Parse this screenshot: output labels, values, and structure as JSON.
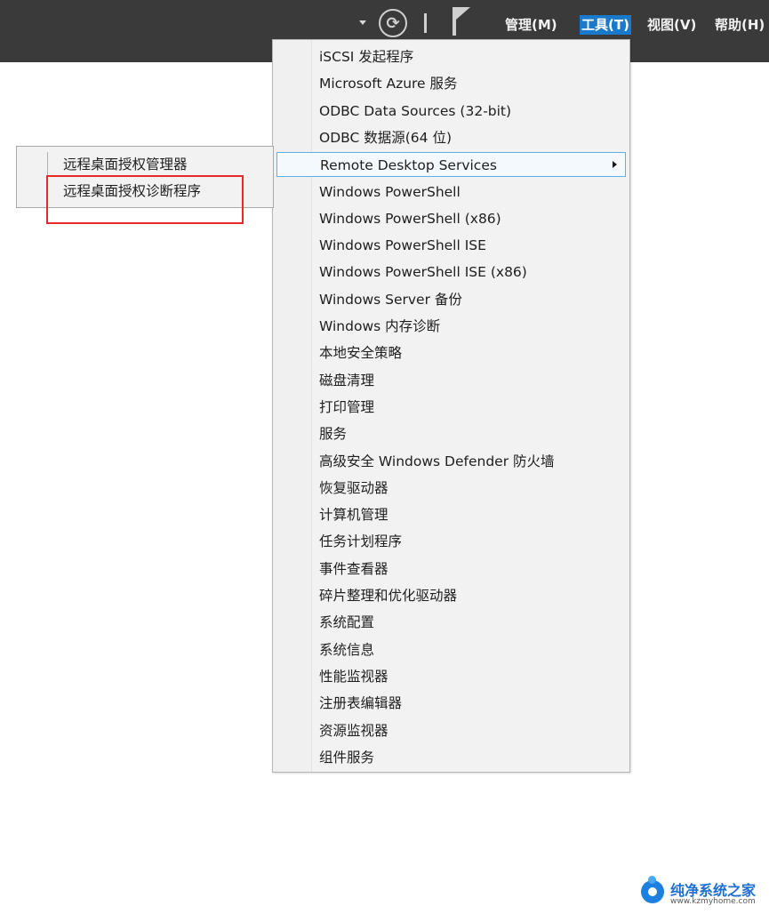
{
  "toolbar": {
    "icons": [
      "dropdown-arrow-icon",
      "refresh-icon",
      "separator",
      "notifications-flag-icon"
    ],
    "menus": [
      {
        "label": "管理(M)",
        "active": false
      },
      {
        "label": "工具(T)",
        "active": true
      },
      {
        "label": "视图(V)",
        "active": false
      },
      {
        "label": "帮助(H)",
        "active": false
      }
    ]
  },
  "tools_menu": {
    "items": [
      {
        "label": "iSCSI 发起程序"
      },
      {
        "label": "Microsoft Azure 服务"
      },
      {
        "label": "ODBC Data Sources (32-bit)"
      },
      {
        "label": "ODBC 数据源(64 位)"
      },
      {
        "label": "Remote Desktop Services",
        "has_submenu": true,
        "highlighted": true
      },
      {
        "label": "Windows PowerShell"
      },
      {
        "label": "Windows PowerShell (x86)"
      },
      {
        "label": "Windows PowerShell ISE"
      },
      {
        "label": "Windows PowerShell ISE (x86)"
      },
      {
        "label": "Windows Server 备份"
      },
      {
        "label": "Windows 内存诊断"
      },
      {
        "label": "本地安全策略"
      },
      {
        "label": "磁盘清理"
      },
      {
        "label": "打印管理"
      },
      {
        "label": "服务"
      },
      {
        "label": "高级安全 Windows Defender 防火墙"
      },
      {
        "label": "恢复驱动器"
      },
      {
        "label": "计算机管理"
      },
      {
        "label": "任务计划程序"
      },
      {
        "label": "事件查看器"
      },
      {
        "label": "碎片整理和优化驱动器"
      },
      {
        "label": "系统配置"
      },
      {
        "label": "系统信息"
      },
      {
        "label": "性能监视器"
      },
      {
        "label": "注册表编辑器"
      },
      {
        "label": "资源监视器"
      },
      {
        "label": "组件服务"
      }
    ]
  },
  "submenu": {
    "items": [
      {
        "label": "远程桌面授权管理器"
      },
      {
        "label": "远程桌面授权诊断程序",
        "annotated": true
      }
    ]
  },
  "annotation": {
    "color": "#e8282a"
  },
  "watermark": {
    "title": "纯净系统之家",
    "url": "www.kzmyhome.com"
  },
  "colors": {
    "titlebar": "#3a3a3a",
    "menu_active": "#1979ca",
    "highlight_border": "#5fb0e6"
  }
}
